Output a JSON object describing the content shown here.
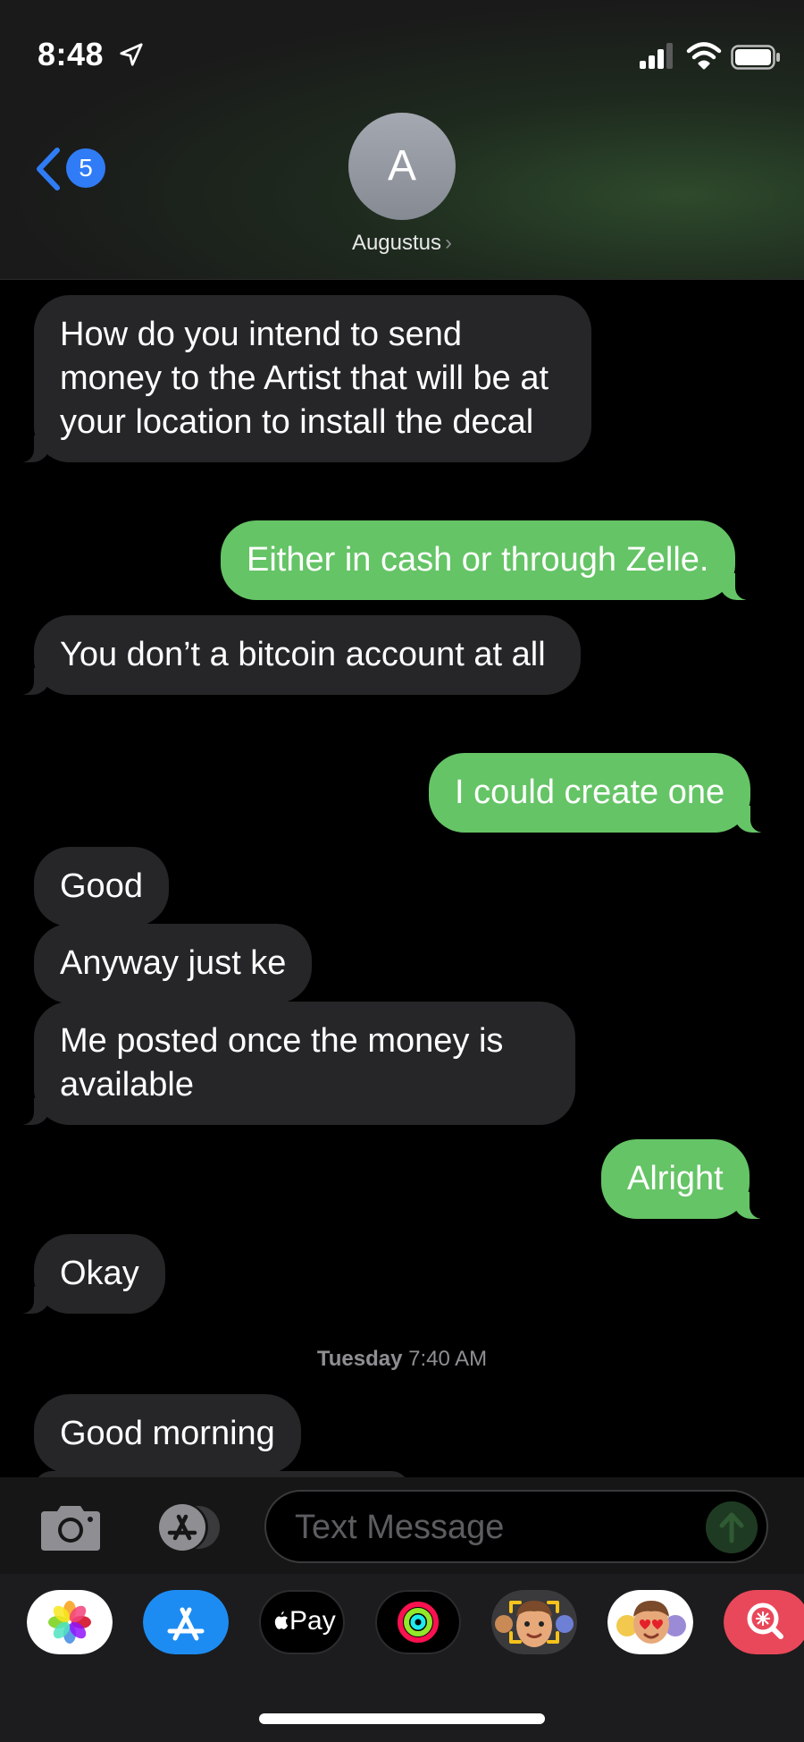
{
  "status_bar": {
    "time": "8:48"
  },
  "nav": {
    "back_count": "5",
    "avatar_initial": "A",
    "contact_name": "Augustus"
  },
  "messages": [
    {
      "dir": "in",
      "text": "How do you intend to send money to the Artist that will be at your location to install the decal"
    },
    {
      "dir": "out",
      "text": "Either in cash or through Zelle."
    },
    {
      "dir": "in",
      "text": "You don’t a bitcoin account at all"
    },
    {
      "dir": "out",
      "text": "I could create one"
    },
    {
      "dir": "in",
      "text": "Good"
    },
    {
      "dir": "in",
      "text": "Anyway just ke"
    },
    {
      "dir": "in",
      "text": "Me posted once the money is available"
    },
    {
      "dir": "out",
      "text": "Alright"
    },
    {
      "dir": "in",
      "text": "Okay"
    },
    {
      "dir": "in",
      "text": "Good morning"
    }
  ],
  "timestamp": {
    "day": "Tuesday",
    "time": "7:40 AM"
  },
  "composer": {
    "placeholder": "Text Message"
  },
  "app_drawer": [
    {
      "name": "photos-app-icon"
    },
    {
      "name": "app-store-app-icon"
    },
    {
      "name": "apple-pay-app-icon",
      "label": "Pay"
    },
    {
      "name": "fitness-app-icon"
    },
    {
      "name": "memoji-app-icon"
    },
    {
      "name": "memoji-stickers-app-icon"
    },
    {
      "name": "search-images-app-icon"
    }
  ],
  "colors": {
    "incoming": "#262628",
    "outgoing": "#65c466",
    "accent": "#2f7cf6"
  }
}
